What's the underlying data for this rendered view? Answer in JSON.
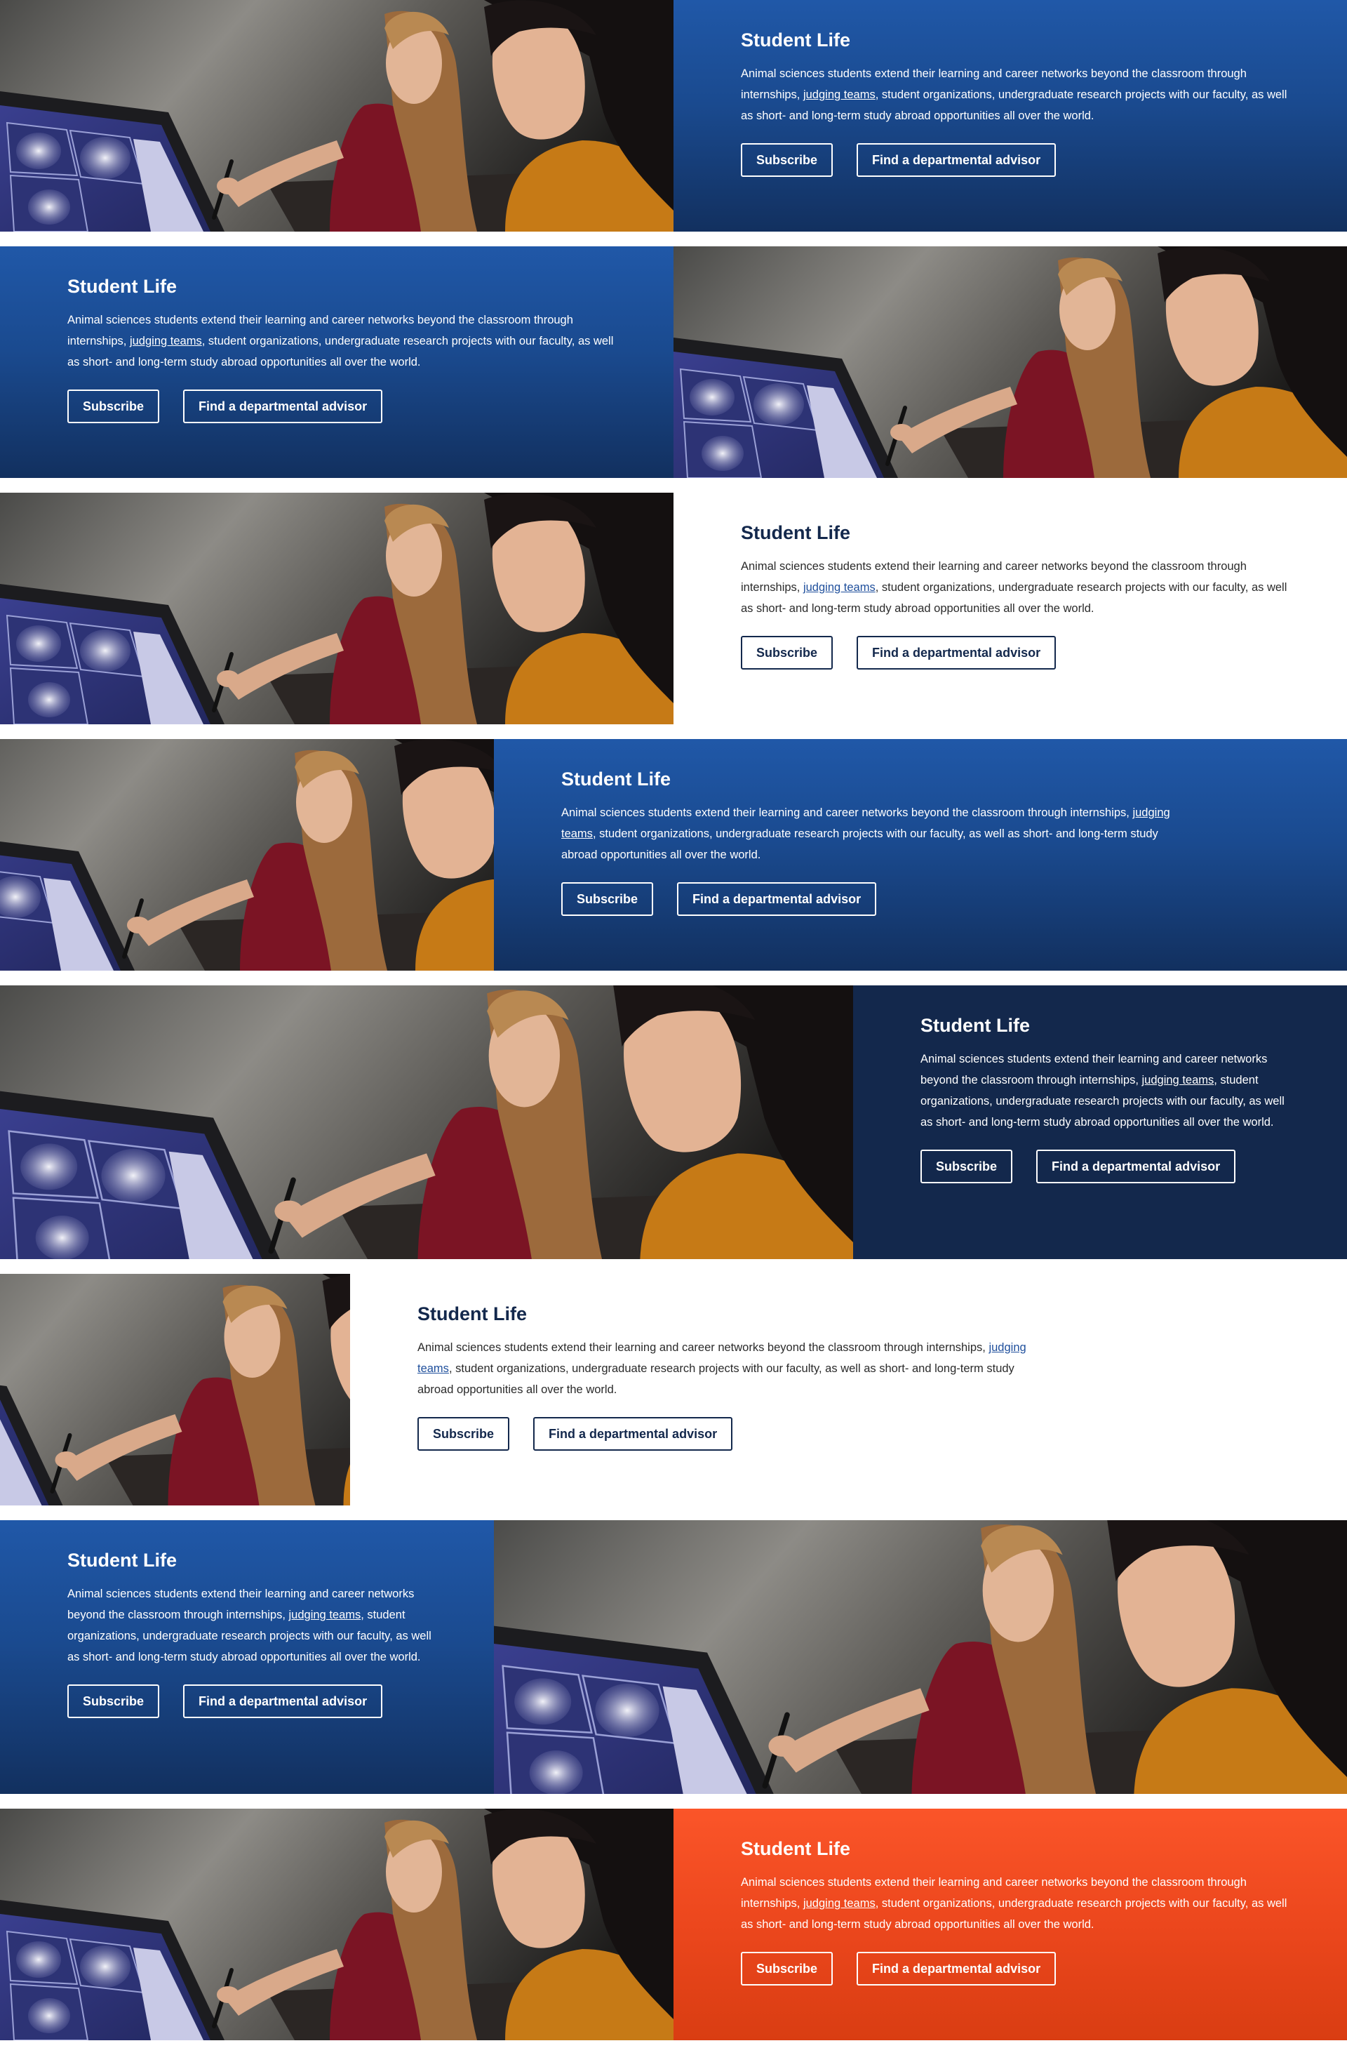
{
  "bands": [
    {
      "id": "band-1",
      "heading": "Student Life",
      "body_before_link": "Animal sciences students extend their learning and career networks beyond the classroom through internships, ",
      "link_text": "judging teams",
      "body_after_link": ", student organizations, undergraduate research projects with our faculty, as well as short- and long-term study abroad opportunities all over the world.",
      "buttons": [
        "Subscribe",
        "Find a departmental advisor"
      ]
    },
    {
      "id": "band-2",
      "heading": "Student Life",
      "body_before_link": "Animal sciences students extend their learning and career networks beyond the classroom through internships, ",
      "link_text": "judging teams",
      "body_after_link": ", student organizations, undergraduate research projects with our faculty, as well as short- and long-term study abroad opportunities all over the world.",
      "buttons": [
        "Subscribe",
        "Find a departmental advisor"
      ]
    },
    {
      "id": "band-3",
      "heading": "Student Life",
      "body_before_link": "Animal sciences students extend their learning and career networks beyond the classroom through internships, ",
      "link_text": "judging teams",
      "body_after_link": ", student organizations, undergraduate research projects with our faculty, as well as short- and long-term study abroad opportunities all over the world.",
      "buttons": [
        "Subscribe",
        "Find a departmental advisor"
      ]
    },
    {
      "id": "band-4",
      "heading": "Student Life",
      "body_before_link": "Animal sciences students extend their learning and career networks beyond the classroom through internships, ",
      "link_text": "judging teams",
      "body_after_link": ", student organizations, undergraduate research projects with our faculty, as well as short- and long-term study abroad opportunities all over the world.",
      "buttons": [
        "Subscribe",
        "Find a departmental advisor"
      ]
    },
    {
      "id": "band-5",
      "heading": "Student Life",
      "body_before_link": "Animal sciences students extend their learning and career networks beyond the classroom through internships, ",
      "link_text": "judging teams",
      "body_after_link": ", student organizations, undergraduate research projects with our faculty, as well as short- and long-term study abroad opportunities all over the world.",
      "buttons": [
        "Subscribe",
        "Find a departmental advisor"
      ]
    },
    {
      "id": "band-6",
      "heading": "Student Life",
      "body_before_link": "Animal sciences students extend their learning and career networks beyond the classroom through internships, ",
      "link_text": "judging teams",
      "body_after_link": ", student organizations, undergraduate research projects with our faculty, as well as short- and long-term study abroad opportunities all over the world.",
      "buttons": [
        "Subscribe",
        "Find a departmental advisor"
      ]
    },
    {
      "id": "band-7",
      "heading": "Student Life",
      "body_before_link": "Animal sciences students extend their learning and career networks beyond the classroom through internships, ",
      "link_text": "judging teams",
      "body_after_link": ", student organizations, undergraduate research projects with our faculty, as well as short- and long-term study abroad opportunities all over the world.",
      "buttons": [
        "Subscribe",
        "Find a departmental advisor"
      ]
    },
    {
      "id": "band-8",
      "heading": "Student Life",
      "body_before_link": "Animal sciences students extend their learning and career networks beyond the classroom through internships, ",
      "link_text": "judging teams",
      "body_after_link": ", student organizations, undergraduate research projects with our faculty, as well as short- and long-term study abroad opportunities all over the world.",
      "buttons": [
        "Subscribe",
        "Find a departmental advisor"
      ]
    }
  ],
  "colors": {
    "blue_top": "#2058a8",
    "blue_bottom": "#12305f",
    "navy": "#13284c",
    "orange_top": "#fb5529",
    "orange_bottom": "#d93d12",
    "white": "#ffffff"
  },
  "image": {
    "subject": "two students examining a 3D animal scan on a large touchscreen"
  }
}
